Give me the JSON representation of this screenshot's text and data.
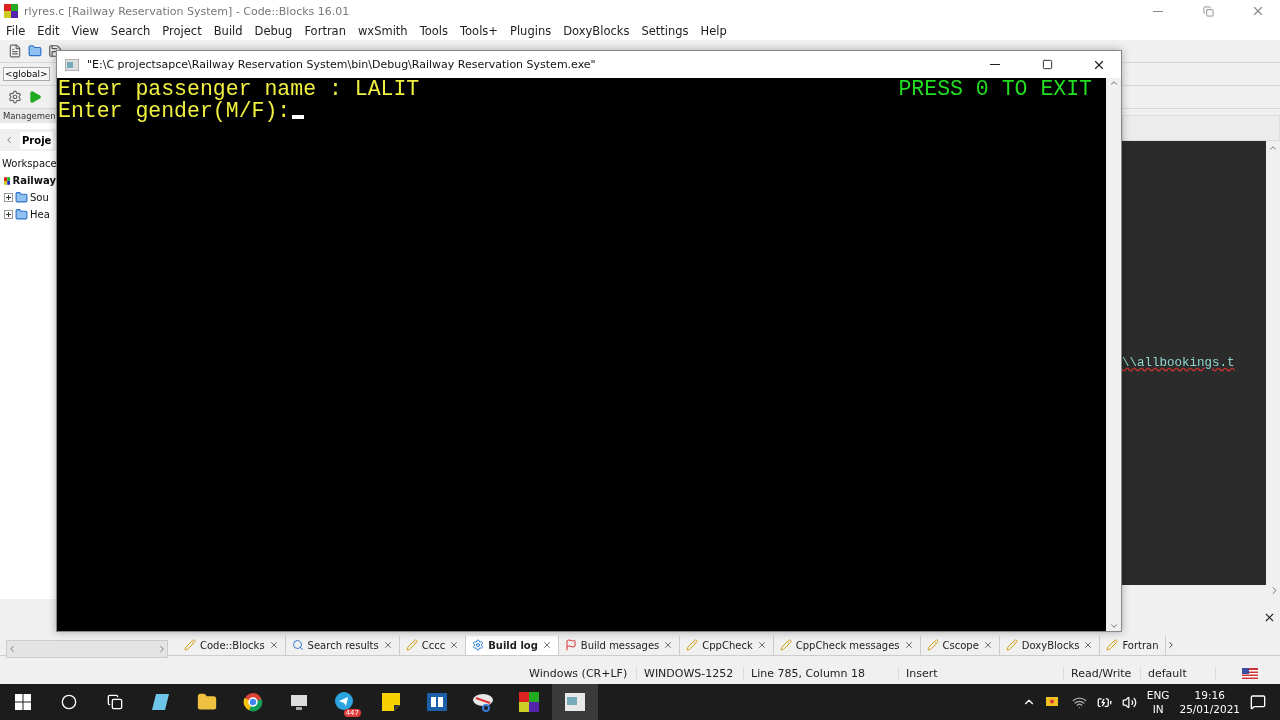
{
  "ide": {
    "title": "rlyres.c [Railway Reservation System] - Code::Blocks 16.01",
    "menu": [
      "File",
      "Edit",
      "View",
      "Search",
      "Project",
      "Build",
      "Debug",
      "Fortran",
      "wxSmith",
      "Tools",
      "Tools+",
      "Plugins",
      "DoxyBlocks",
      "Settings",
      "Help"
    ],
    "scope_field": "<global>",
    "management_label": "Managemen",
    "project_tab": "Proje",
    "workspace_label": "Workspace",
    "tree": [
      {
        "label": "Railway",
        "children": [
          {
            "label": "Sou",
            "expanded": false
          },
          {
            "label": "Hea",
            "expanded": false
          }
        ]
      }
    ],
    "editor_line": "\\\\allbookings.t",
    "log_tabs": [
      {
        "label": "Code::Blocks",
        "kind": "pencil",
        "selected": false
      },
      {
        "label": "Search results",
        "kind": "search",
        "selected": false
      },
      {
        "label": "Cccc",
        "kind": "pencil",
        "selected": false
      },
      {
        "label": "Build log",
        "kind": "gear",
        "selected": true
      },
      {
        "label": "Build messages",
        "kind": "flag",
        "selected": false
      },
      {
        "label": "CppCheck",
        "kind": "pencil",
        "selected": false
      },
      {
        "label": "CppCheck messages",
        "kind": "pencil",
        "selected": false
      },
      {
        "label": "Cscope",
        "kind": "pencil",
        "selected": false
      },
      {
        "label": "DoxyBlocks",
        "kind": "pencil",
        "selected": false
      },
      {
        "label": "Fortran",
        "kind": "pencil",
        "selected": false
      }
    ],
    "status_bar": [
      "Windows (CR+LF)",
      "WINDOWS-1252",
      "Line 785, Column 18",
      "Insert",
      "Read/Write",
      "default"
    ]
  },
  "console": {
    "title": "\"E:\\C projectsapce\\Railway Reservation System\\bin\\Debug\\Railway Reservation System.exe\"",
    "lines": [
      "Enter passenger name : LALIT",
      "Enter gender(M/F):"
    ],
    "banner": "PRESS 0 TO EXIT"
  },
  "taskbar": {
    "badge": "447",
    "language": "ENG",
    "region": "IN",
    "time": "19:16",
    "date": "25/01/2021"
  }
}
